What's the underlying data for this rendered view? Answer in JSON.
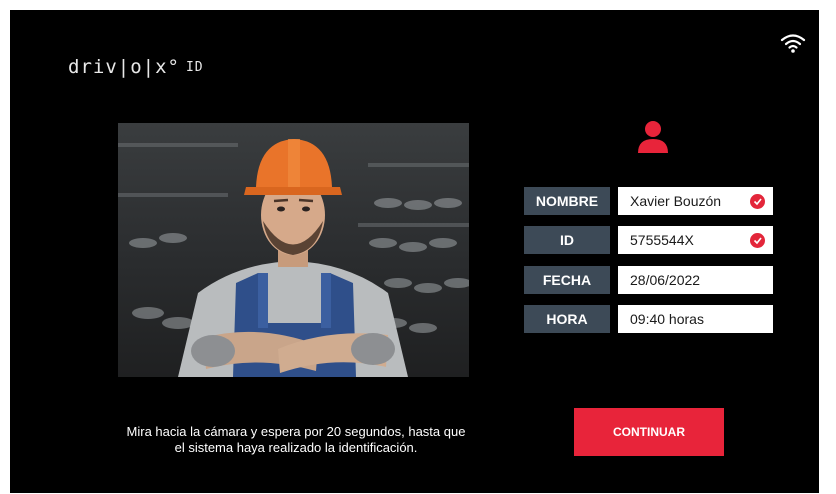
{
  "header": {
    "logo_text": "driv|o|x°",
    "logo_suffix": "ID"
  },
  "status": {
    "wifi_icon": "wifi-icon"
  },
  "profile": {
    "icon": "user-icon",
    "accent_color": "#e8243a"
  },
  "fields": [
    {
      "label": "NOMBRE",
      "value": "Xavier Bouzón",
      "verified": true
    },
    {
      "label": "ID",
      "value": "5755544X",
      "verified": true
    },
    {
      "label": "FECHA",
      "value": "28/06/2022",
      "verified": false
    },
    {
      "label": "HORA",
      "value": "09:40 horas",
      "verified": false
    }
  ],
  "instructions": {
    "line1": "Mira hacia la cámara y espera por 20 segundos, hasta que",
    "line2": "el sistema haya realizado la identificación."
  },
  "actions": {
    "continue_label": "CONTINUAR"
  },
  "colors": {
    "label_bg": "#3d4a57",
    "check": "#e3263a",
    "background": "#000000"
  }
}
